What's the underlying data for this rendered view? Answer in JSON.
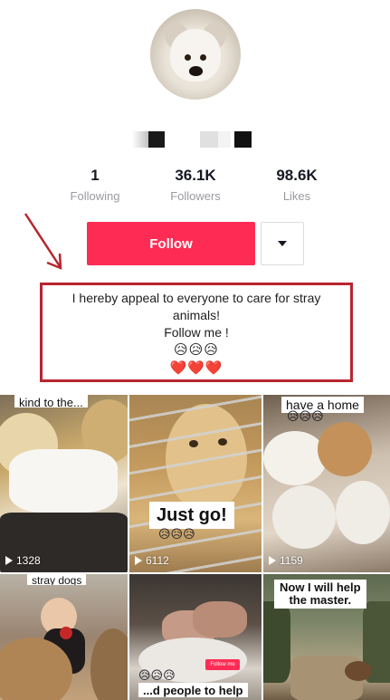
{
  "profile": {
    "following_count": "1",
    "following_label": "Following",
    "followers_count": "36.1K",
    "followers_label": "Followers",
    "likes_count": "98.6K",
    "likes_label": "Likes",
    "follow_label": "Follow"
  },
  "bio": {
    "line1": "I hereby appeal to everyone to care for stray",
    "line2": "animals!",
    "line3": "Follow me !",
    "emoji_row1": "😥😥😥",
    "emoji_row2": "❤️❤️❤️"
  },
  "videos": [
    {
      "caption": "kind to the...",
      "views": "1328"
    },
    {
      "caption": "Just go!",
      "caption_emoji": "😥😥😥",
      "views": "6112"
    },
    {
      "caption": "have a home",
      "caption_emoji": "😥😥😥",
      "views": "1159"
    },
    {
      "caption": "stray dogs"
    },
    {
      "caption": "...d people to help",
      "caption_emoji": "😥😥😥",
      "chip": "Follow me"
    },
    {
      "caption_line1": "Now I will help",
      "caption_line2": "the master."
    }
  ],
  "colors": {
    "accent": "#fe2c55",
    "annotation": "#b8252f"
  },
  "icons": {
    "dropdown": "caret-down-icon",
    "play": "play-icon",
    "annotation": "red-arrow-icon"
  }
}
